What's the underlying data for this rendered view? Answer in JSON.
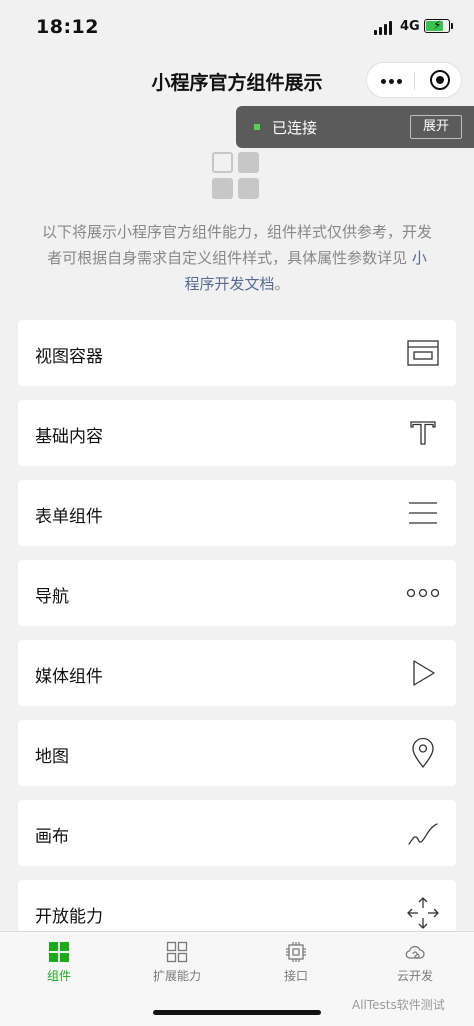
{
  "status_bar": {
    "time": "18:12",
    "network": "4G"
  },
  "nav": {
    "title": "小程序官方组件展示"
  },
  "toast": {
    "text": "已连接",
    "button": "展开"
  },
  "intro": {
    "text": "以下将展示小程序官方组件能力，组件样式仅供参考，开发者可根据自身需求自定义组件样式，具体属性参数详见 ",
    "link": "小程序开发文档",
    "suffix": "。"
  },
  "menu": [
    {
      "label": "视图容器",
      "icon": "view-container-icon"
    },
    {
      "label": "基础内容",
      "icon": "text-t-icon"
    },
    {
      "label": "表单组件",
      "icon": "form-lines-icon"
    },
    {
      "label": "导航",
      "icon": "navigation-dots-icon"
    },
    {
      "label": "媒体组件",
      "icon": "play-icon"
    },
    {
      "label": "地图",
      "icon": "map-pin-icon"
    },
    {
      "label": "画布",
      "icon": "canvas-curve-icon"
    },
    {
      "label": "开放能力",
      "icon": "open-arrows-icon"
    }
  ],
  "tabs": [
    {
      "label": "组件",
      "active": true
    },
    {
      "label": "扩展能力",
      "active": false
    },
    {
      "label": "接口",
      "active": false
    },
    {
      "label": "云开发",
      "active": false
    }
  ],
  "watermark": "AllTests软件测试",
  "colors": {
    "accent": "#1aad19",
    "link": "#576b95",
    "toast_bg": "#5b5b5b"
  }
}
